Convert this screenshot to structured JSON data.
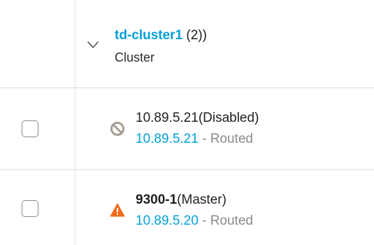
{
  "group": {
    "name": "td-cluster1",
    "count_text": " (2))",
    "type_label": "Cluster"
  },
  "devices": [
    {
      "name": "10.89.5.21",
      "name_bold": false,
      "role": "(Disabled)",
      "ip": "10.89.5.21",
      "separator": " - ",
      "mode": "Routed",
      "status_icon": "disabled-icon",
      "status_color": "#a89c92"
    },
    {
      "name": "9300-1",
      "name_bold": true,
      "role": "(Master)",
      "ip": "10.89.5.20",
      "separator": " - ",
      "mode": "Routed",
      "status_icon": "warning-icon",
      "status_color": "#f26b1d"
    }
  ],
  "colors": {
    "link": "#049fd9",
    "text": "#1f1f1f",
    "muted": "#8a8a8a",
    "divider": "#dcdcdc"
  }
}
